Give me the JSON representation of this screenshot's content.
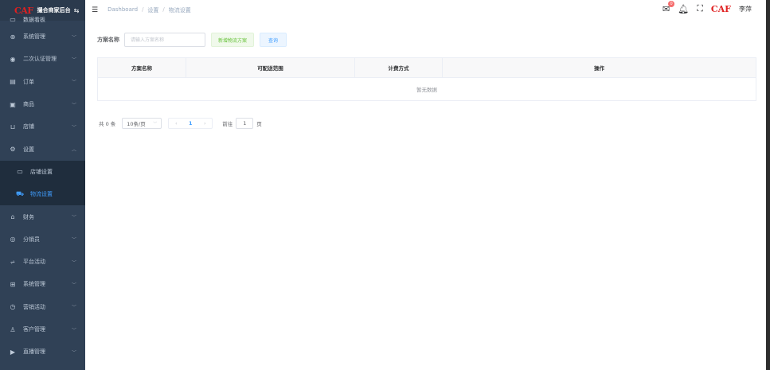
{
  "sidebar": {
    "logo": "CAF",
    "title": "撮合商家后台",
    "items": [
      {
        "label": "数据看板",
        "icon": "monitor-icon"
      },
      {
        "label": "系统管理",
        "icon": "plus-circle-icon"
      },
      {
        "label": "二次认证管理",
        "icon": "eye-icon"
      },
      {
        "label": "订单",
        "icon": "document-icon"
      },
      {
        "label": "商品",
        "icon": "gift-icon"
      },
      {
        "label": "店铺",
        "icon": "shop-icon"
      },
      {
        "label": "设置",
        "icon": "gear-icon"
      },
      {
        "label": "财务",
        "icon": "wallet-icon"
      },
      {
        "label": "分销员",
        "icon": "globe-icon"
      },
      {
        "label": "平台活动",
        "icon": "chart-icon"
      },
      {
        "label": "系统管理",
        "icon": "chip-icon"
      },
      {
        "label": "营销活动",
        "icon": "clock-icon"
      },
      {
        "label": "客户管理",
        "icon": "user-icon"
      },
      {
        "label": "直播管理",
        "icon": "video-icon"
      }
    ],
    "settings_sub": [
      {
        "label": "店铺设置",
        "icon": "monitor-icon"
      },
      {
        "label": "物流设置",
        "icon": "truck-icon"
      }
    ]
  },
  "navbar": {
    "breadcrumb": [
      "Dashboard",
      "设置",
      "物流设置"
    ],
    "badge_count": "0",
    "logo": "CAF",
    "username": "李萍"
  },
  "search": {
    "label": "方案名称",
    "placeholder": "请输入方案名称",
    "add_label": "新增物流方案",
    "query_label": "查询"
  },
  "table": {
    "columns": [
      "方案名称",
      "可配送范围",
      "计费方式",
      "操作"
    ],
    "empty_text": "暂无数据"
  },
  "pagination": {
    "total_text": "共 0 条",
    "page_size": "10条/页",
    "current_page": "1",
    "goto_prefix": "前往",
    "goto_value": "1",
    "goto_suffix": "页"
  }
}
